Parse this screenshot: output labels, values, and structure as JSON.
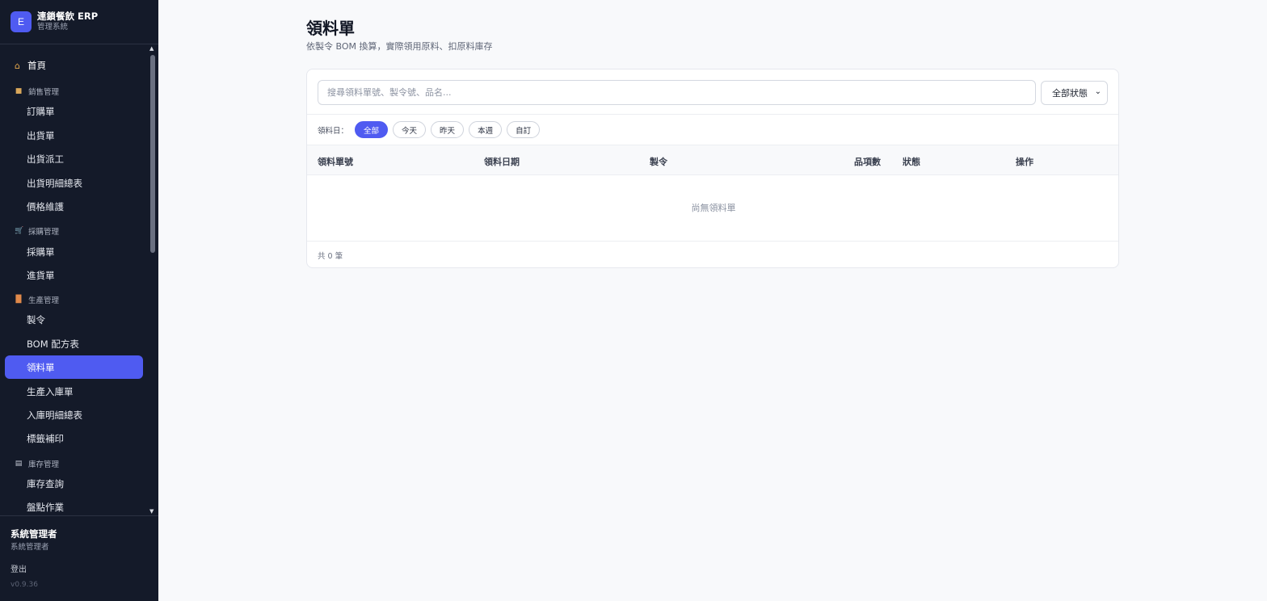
{
  "brand": {
    "logo_letter": "E",
    "title": "連鎖餐飲 ERP",
    "subtitle": "管理系統"
  },
  "nav": {
    "home": {
      "label": "首頁",
      "icon": "home-icon"
    },
    "sections": [
      {
        "label": "銷售管理",
        "icon": "box-icon",
        "items": [
          "訂購單",
          "出貨單",
          "出貨派工",
          "出貨明細總表",
          "價格維護"
        ]
      },
      {
        "label": "採購管理",
        "icon": "cart-icon",
        "items": [
          "採購單",
          "進貨單"
        ]
      },
      {
        "label": "生產管理",
        "icon": "factory-icon",
        "items": [
          "製令",
          "BOM 配方表",
          "領料單",
          "生產入庫單",
          "入庫明細總表",
          "標籤補印"
        ]
      },
      {
        "label": "庫存管理",
        "icon": "warehouse-icon",
        "items": [
          "庫存查詢",
          "盤點作業"
        ]
      }
    ],
    "active_item": "領料單"
  },
  "user": {
    "name": "系統管理者",
    "role": "系統管理者",
    "logout": "登出",
    "version": "v0.9.36"
  },
  "page": {
    "title": "領料單",
    "description": "依製令 BOM 換算，實際領用原料、扣原料庫存"
  },
  "search": {
    "placeholder": "搜尋領料單號、製令號、品名...",
    "value": ""
  },
  "status_filter": {
    "selected": "全部狀態"
  },
  "date_filter": {
    "label": "領料日：",
    "options": [
      "全部",
      "今天",
      "昨天",
      "本週",
      "自訂"
    ],
    "selected": "全部"
  },
  "table": {
    "columns": [
      "領料單號",
      "領料日期",
      "製令",
      "品項數",
      "狀態",
      "操作"
    ],
    "rows": [],
    "empty_text": "尚無領料單",
    "total_text": "共 0 筆"
  },
  "colors": {
    "accent": "#4f5bf1",
    "sidebar_bg": "#141a29",
    "page_bg": "#f8f9fb"
  }
}
